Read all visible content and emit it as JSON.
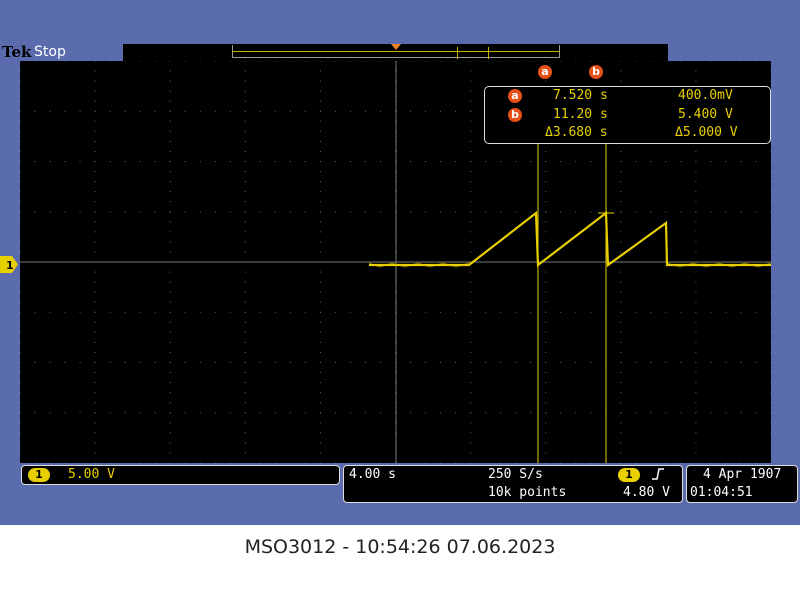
{
  "header": {
    "brand": "Tek",
    "status": "Stop"
  },
  "channel": {
    "marker": "1",
    "scale": "5.00 V",
    "trace_color": "#e8d000"
  },
  "cursors": {
    "a_label": "a",
    "b_label": "b",
    "a_time": "7.520 s",
    "a_volt": "400.0mV",
    "b_time": "11.20 s",
    "b_volt": "5.400 V",
    "delta_time": "Δ3.680 s",
    "delta_volt": "Δ5.000 V",
    "badge_color": "#e8501a"
  },
  "timebase": {
    "scale": "4.00 s",
    "sample_rate": "250 S/s",
    "record_length": "10k points"
  },
  "trigger": {
    "source": "1",
    "slope_icon": "rising-edge-icon",
    "level": "4.80 V"
  },
  "clock": {
    "date": "4 Apr  1907",
    "time": "01:04:51"
  },
  "caption": "MSO3012 - 10:54:26   07.06.2023"
}
